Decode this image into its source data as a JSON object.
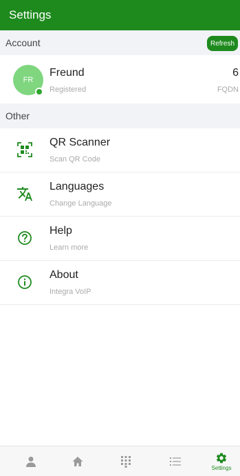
{
  "app_bar": {
    "title": "Settings"
  },
  "account_section": {
    "header": "Account",
    "refresh_label": "Refresh",
    "account": {
      "initials": "FR",
      "name": "Freund",
      "status": "Registered",
      "count": "6",
      "type": "FQDN"
    }
  },
  "other_section": {
    "header": "Other",
    "items": [
      {
        "title": "QR Scanner",
        "subtitle": "Scan QR Code",
        "icon": "qr-code-icon"
      },
      {
        "title": "Languages",
        "subtitle": "Change Language",
        "icon": "translate-icon"
      },
      {
        "title": "Help",
        "subtitle": "Learn more",
        "icon": "help-circle-icon"
      },
      {
        "title": "About",
        "subtitle": "Integra VoIP",
        "icon": "info-circle-icon"
      }
    ]
  },
  "bottom_nav": {
    "items": [
      {
        "icon": "person-icon",
        "label": ""
      },
      {
        "icon": "home-icon",
        "label": ""
      },
      {
        "icon": "dialpad-icon",
        "label": ""
      },
      {
        "icon": "list-icon",
        "label": ""
      },
      {
        "icon": "gear-icon",
        "label": "Settings",
        "active": true
      }
    ]
  },
  "colors": {
    "accent": "#1e8a1e",
    "avatar": "#7fd67f",
    "section_bg": "#f1f3f6",
    "inactive_icon": "#9a9a9a"
  }
}
